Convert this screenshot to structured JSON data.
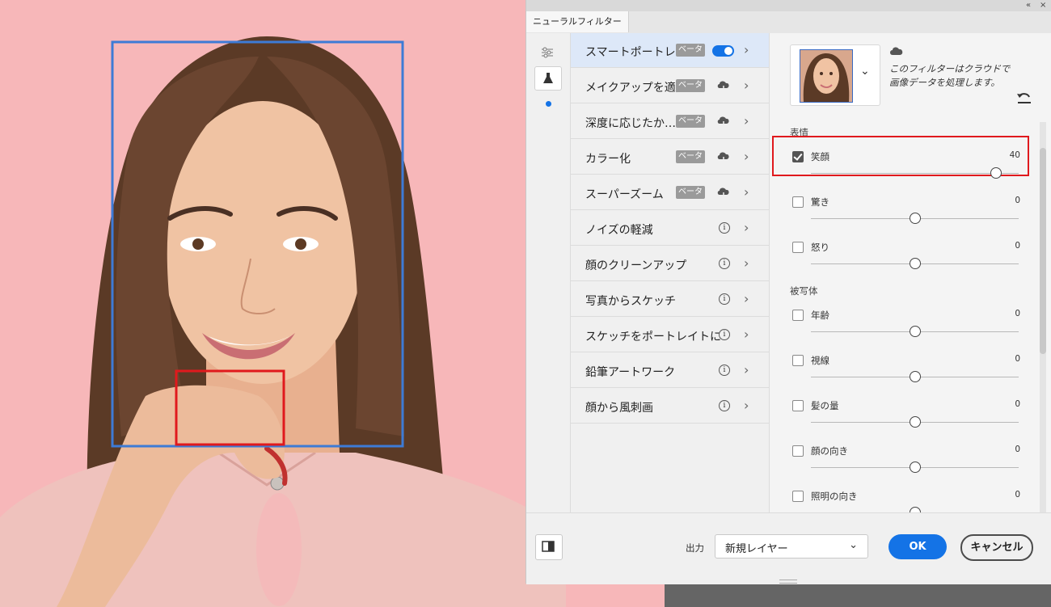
{
  "panel": {
    "tab_label": "ニューラルフィルター",
    "collapse_glyph": "«",
    "close_glyph": "×"
  },
  "filters": [
    {
      "label": "スマートポートレイト",
      "badge": "ベータ",
      "control": "toggle",
      "active": true
    },
    {
      "label": "メイクアップを適用",
      "badge": "ベータ",
      "control": "cloud"
    },
    {
      "label": "深度に応じたか…",
      "badge": "ベータ",
      "control": "cloud"
    },
    {
      "label": "カラー化",
      "badge": "ベータ",
      "control": "cloud"
    },
    {
      "label": "スーパーズーム",
      "badge": "ベータ",
      "control": "cloud"
    },
    {
      "label": "ノイズの軽減",
      "badge": "",
      "control": "info"
    },
    {
      "label": "顔のクリーンアップ",
      "badge": "",
      "control": "info"
    },
    {
      "label": "写真からスケッチ",
      "badge": "",
      "control": "info"
    },
    {
      "label": "スケッチをポートレイトに",
      "badge": "",
      "control": "info"
    },
    {
      "label": "鉛筆アートワーク",
      "badge": "",
      "control": "info"
    },
    {
      "label": "顔から風刺画",
      "badge": "",
      "control": "info"
    }
  ],
  "settings": {
    "cloud_note": "このフィルターはクラウドで画像データを処理します。",
    "sections": [
      {
        "label": "表情"
      },
      {
        "label": "被写体"
      }
    ],
    "params": [
      {
        "label": "笑顔",
        "value": "40",
        "checked": true,
        "level": 0.89
      },
      {
        "label": "驚き",
        "value": "0",
        "checked": false,
        "level": 0.5
      },
      {
        "label": "怒り",
        "value": "0",
        "checked": false,
        "level": 0.5
      },
      {
        "label": "年齢",
        "value": "0",
        "checked": false,
        "level": 0.5
      },
      {
        "label": "視線",
        "value": "0",
        "checked": false,
        "level": 0.5
      },
      {
        "label": "髪の量",
        "value": "0",
        "checked": false,
        "level": 0.5
      },
      {
        "label": "顔の向き",
        "value": "0",
        "checked": false,
        "level": 0.5
      },
      {
        "label": "照明の向き",
        "value": "0",
        "checked": false,
        "level": 0.5
      }
    ]
  },
  "footer": {
    "output_label": "出力",
    "output_value": "新規レイヤー",
    "ok_label": "OK",
    "cancel_label": "キャンセル"
  },
  "colors": {
    "accent": "#1473e6",
    "highlight_red": "#e0191d",
    "face_box_blue": "#3d7bd6",
    "background_pink": "#f7b7b9"
  }
}
